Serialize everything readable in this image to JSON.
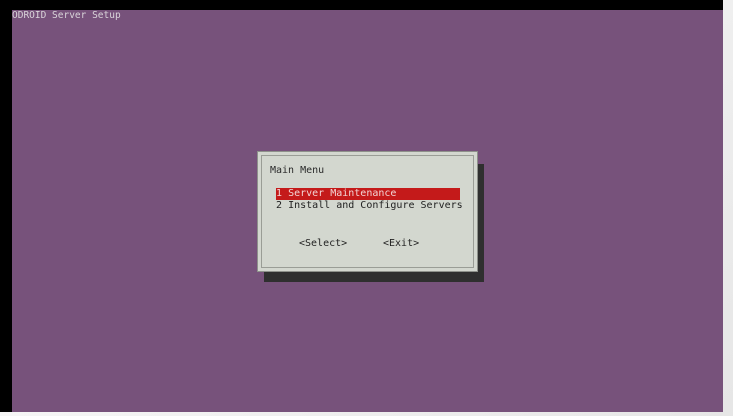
{
  "window": {
    "backtitle": "ODROID Server Setup"
  },
  "dialog": {
    "title": "Main Menu",
    "items": [
      {
        "key": "1",
        "label": "Server Maintenance",
        "selected": true
      },
      {
        "key": "2",
        "label": "Install and Configure Servers",
        "selected": false
      }
    ],
    "buttons": {
      "select": "<Select>",
      "exit": "<Exit>"
    }
  },
  "colors": {
    "background": "#77527b",
    "dialog": "#d3d7cf",
    "highlight": "#c41a1a",
    "shadow": "#2f2f2f"
  }
}
